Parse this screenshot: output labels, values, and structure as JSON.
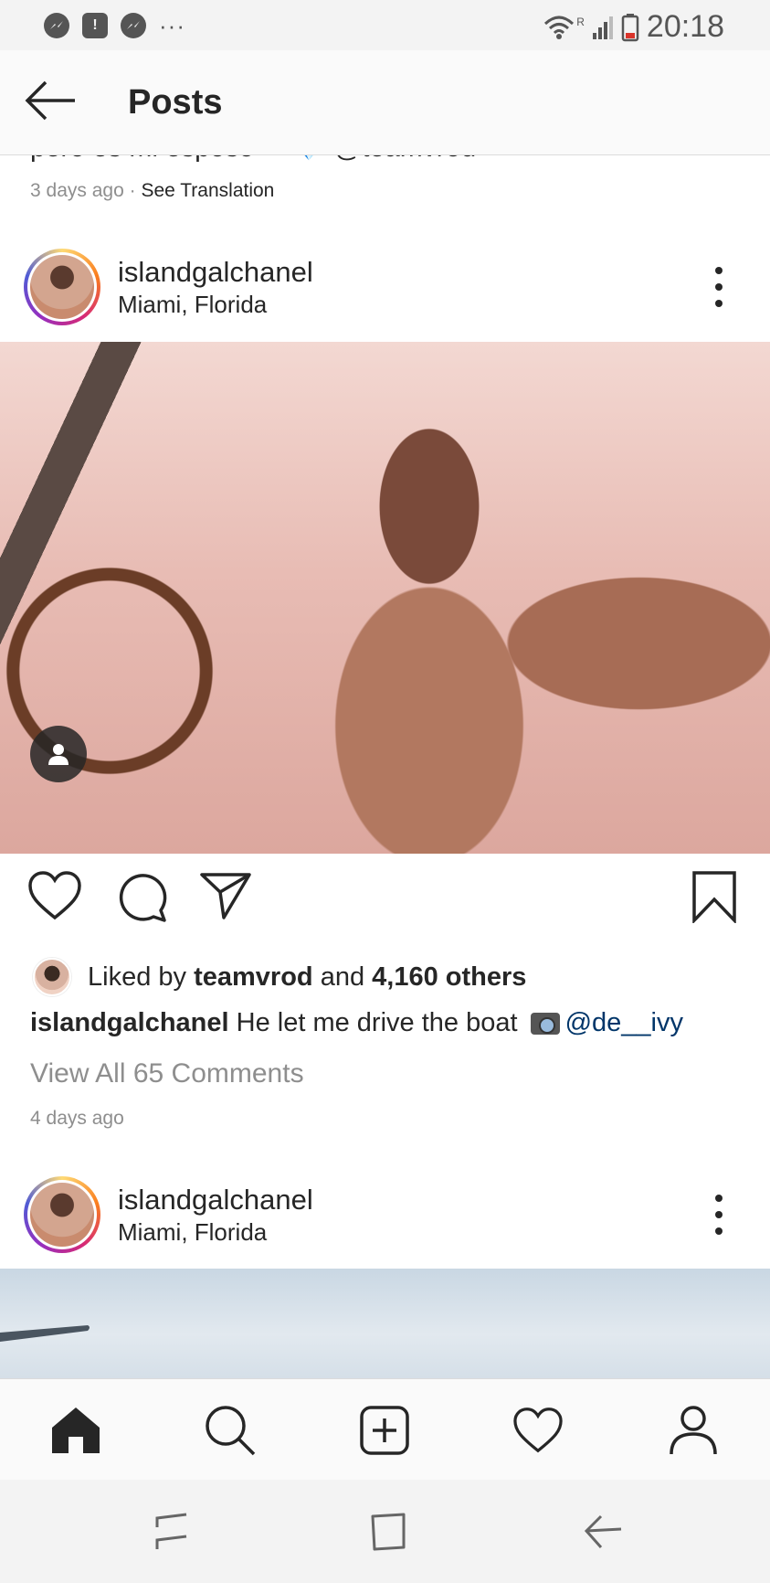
{
  "status_bar": {
    "left_icons": [
      "messenger-icon",
      "alert-icon",
      "messenger-icon"
    ],
    "dots": "···",
    "time": "20:18",
    "network_label": "R"
  },
  "header": {
    "title": "Posts"
  },
  "previous_post": {
    "caption_partial": "pero es mi esposo ❤ 💎 @teamvrod",
    "time": "3 days ago",
    "separator": "·",
    "see_translation": "See Translation"
  },
  "post": {
    "username": "islandgalchanel",
    "location": "Miami, Florida",
    "likes_prefix": "Liked by",
    "liked_by_user": "teamvrod",
    "likes_and": "and",
    "likes_count": "4,160 others",
    "caption_user": "islandgalchanel",
    "caption_text": "He let me drive the boat",
    "caption_mention": "@de__ivy",
    "view_comments": "View All 65 Comments",
    "time": "4 days ago"
  },
  "next_post": {
    "username": "islandgalchanel",
    "location": "Miami, Florida"
  },
  "bottom_nav": [
    "home-icon",
    "search-icon",
    "new-post-icon",
    "activity-heart-icon",
    "profile-icon"
  ],
  "system_nav": [
    "recents-icon",
    "home-square-icon",
    "back-arrow-icon"
  ],
  "colors": {
    "text": "#262626",
    "secondary": "#8e8e8e",
    "mention": "#003569",
    "border": "#dbdbdb"
  }
}
